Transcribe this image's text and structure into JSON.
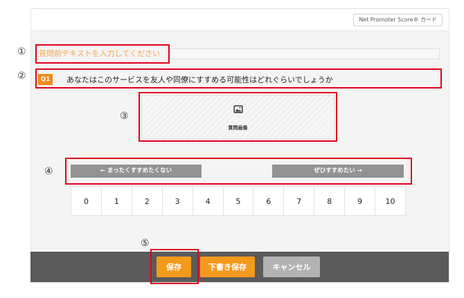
{
  "header": {
    "tag_label": "Net Promoter Score® カード"
  },
  "annotations": [
    "①",
    "②",
    "③",
    "④",
    "⑤"
  ],
  "question": {
    "pre_text_placeholder": "質問前テキストを入力してください",
    "badge": "Q1",
    "text": "あなたはこのサービスを友人や同僚にすすめる可能性はどれぐらいでしょうか",
    "image_label": "質問画像",
    "image_icon": "image-icon"
  },
  "scale": {
    "left_label": "← まったくすすめたくない",
    "right_label": "ぜひすすめたい →",
    "values": [
      "0",
      "1",
      "2",
      "3",
      "4",
      "5",
      "6",
      "7",
      "8",
      "9",
      "10"
    ]
  },
  "footer": {
    "save": "保存",
    "draft_save": "下書き保存",
    "cancel": "キャンセル"
  },
  "colors": {
    "accent_orange": "#f39a1d",
    "badge_orange": "#f08a18",
    "cancel_gray": "#b3b3b3",
    "footer_bg": "#5b5b5b",
    "annotation_red": "#e0001a",
    "scale_label_gray": "#939393"
  }
}
